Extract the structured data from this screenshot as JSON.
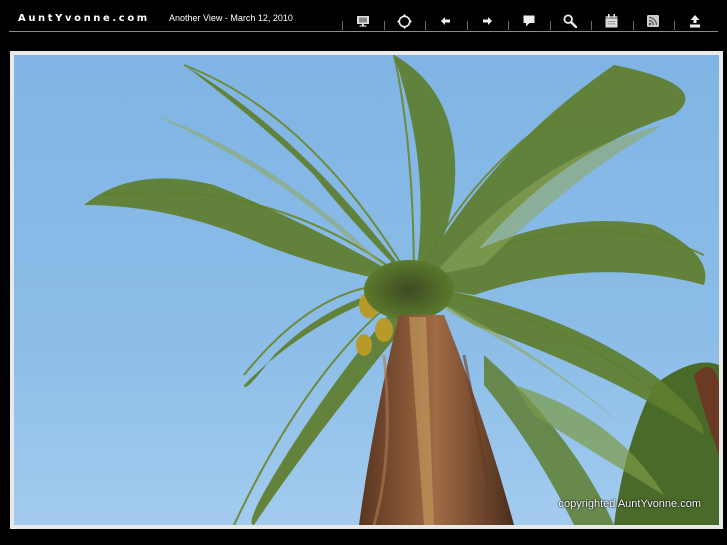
{
  "header": {
    "site_title": "AuntYvonne.com",
    "post_title": "Another View - March 12, 2010"
  },
  "toolbar": {
    "icons": [
      {
        "name": "monitor-icon"
      },
      {
        "name": "fullscreen-icon"
      },
      {
        "name": "arrow-left-icon"
      },
      {
        "name": "arrow-right-icon"
      },
      {
        "name": "comment-icon"
      },
      {
        "name": "search-icon"
      },
      {
        "name": "calendar-icon"
      },
      {
        "name": "rss-icon"
      },
      {
        "name": "user-icon"
      }
    ]
  },
  "photo": {
    "copyright": "copyrighted AuntYvonne.com"
  },
  "colors": {
    "background": "#000000",
    "frame": "#e9e9e9",
    "sky": "#86b8e6",
    "frond": "#5b7a2c",
    "trunk": "#8a5a36"
  }
}
